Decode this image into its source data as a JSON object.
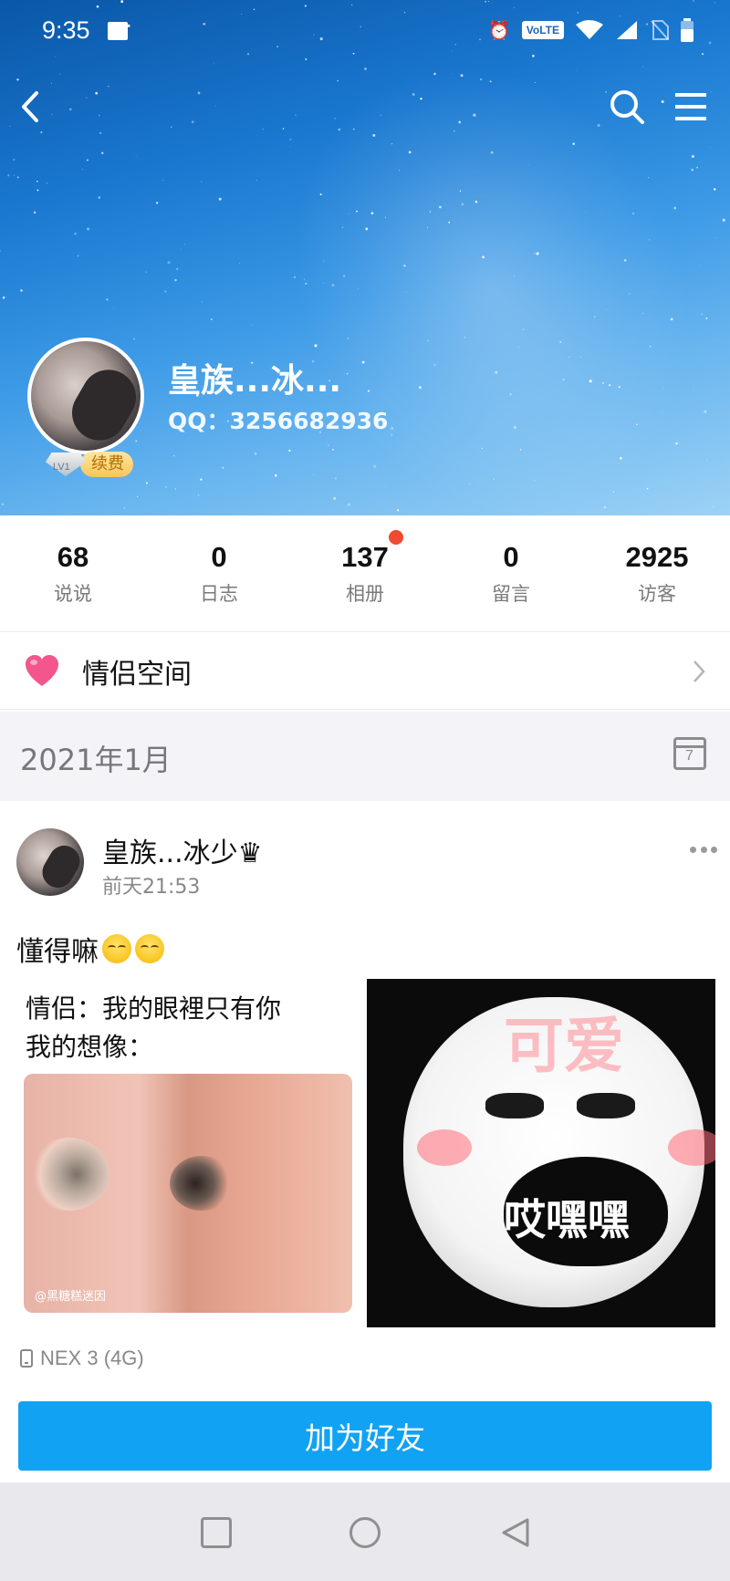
{
  "status_bar": {
    "time": "9:35",
    "volte": "VoLTE"
  },
  "profile": {
    "name": "皇族...冰...",
    "qq": "QQ：3256682936",
    "level": "LV1",
    "renew_label": "续费"
  },
  "stats": [
    {
      "value": "68",
      "label": "说说"
    },
    {
      "value": "0",
      "label": "日志"
    },
    {
      "value": "137",
      "label": "相册"
    },
    {
      "value": "0",
      "label": "留言"
    },
    {
      "value": "2925",
      "label": "访客"
    }
  ],
  "couple_space": {
    "label": "情侣空间"
  },
  "date_divider": {
    "label": "2021年1月",
    "calendar_day": "7"
  },
  "post": {
    "author": "皇族...冰少♛",
    "time": "前天21:53",
    "text": "懂得嘛",
    "image_left": {
      "caption": "情侣：我的眼裡只有你\n我的想像：",
      "watermark": "@黑糖糕迷因"
    },
    "image_right": {
      "top_text": "可爱",
      "bottom_text": "哎嘿嘿"
    },
    "device": "NEX 3 (4G)"
  },
  "action": {
    "add_friend_label": "加为好友"
  },
  "colors": {
    "accent": "#12a2f3",
    "badge_dot": "#f04a32",
    "heart": "#f2568c"
  }
}
